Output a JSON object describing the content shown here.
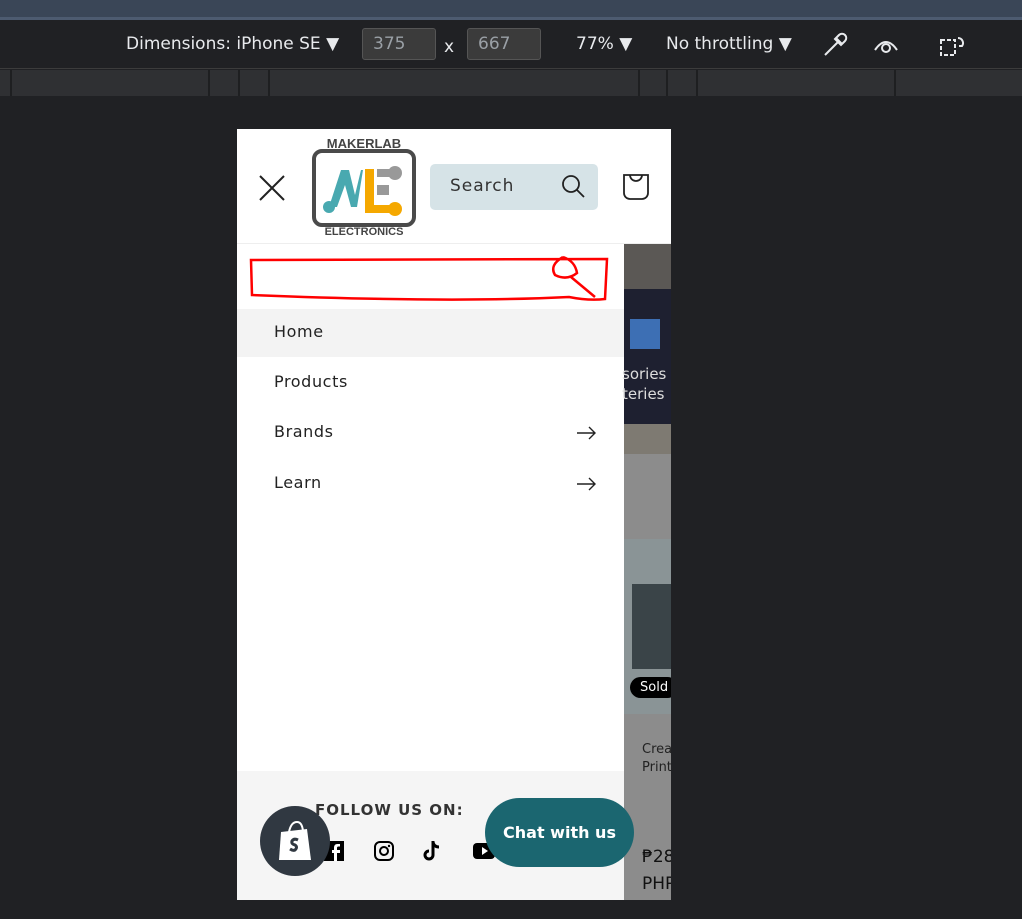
{
  "devtools": {
    "dimensions_label": "Dimensions: iPhone SE",
    "width": "375",
    "height": "667",
    "times": "x",
    "zoom": "77%",
    "throttling": "No throttling"
  },
  "site": {
    "logo_top": "MAKERLAB",
    "logo_bottom": "ELECTRONICS",
    "search_label": "Search",
    "menu": [
      {
        "label": "Home",
        "arrow": false
      },
      {
        "label": "Products",
        "arrow": false
      },
      {
        "label": "Brands",
        "arrow": true
      },
      {
        "label": "Learn",
        "arrow": true
      }
    ],
    "follow_label": "FOLLOW US ON:",
    "social": [
      "facebook-icon",
      "instagram-icon",
      "tiktok-icon",
      "youtube-icon"
    ],
    "chat_label": "Chat with us",
    "bg_fragments": {
      "cat1": "sories",
      "cat2": "teries",
      "badge": "Sold",
      "product1": "Crea",
      "product2": "Print",
      "price": "₱28",
      "currency": "PHP"
    }
  },
  "colors": {
    "accent": "#1b6670",
    "search_bg": "#d6e3e7",
    "annotation": "#ff0000"
  }
}
